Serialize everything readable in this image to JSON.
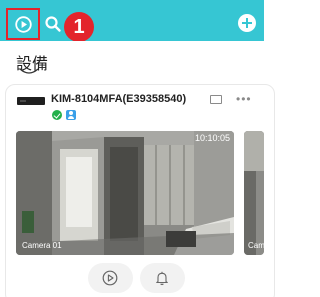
{
  "header": {
    "playback_icon": "playback-icon",
    "search_icon": "search-icon",
    "add_icon": "add-icon",
    "step_badge": "1",
    "accent_color": "#36c6d3",
    "highlight_color": "#e3242b"
  },
  "section": {
    "title": "設備"
  },
  "device": {
    "name": "KIM-8104MFA(E39358540)",
    "status": "online",
    "status_color": "#22b04b"
  },
  "cameras": [
    {
      "label": "Camera 01",
      "time": "10:10:05"
    },
    {
      "label": "Camera 02"
    }
  ],
  "controls": [
    {
      "icon": "play-icon"
    },
    {
      "icon": "bell-icon"
    }
  ]
}
